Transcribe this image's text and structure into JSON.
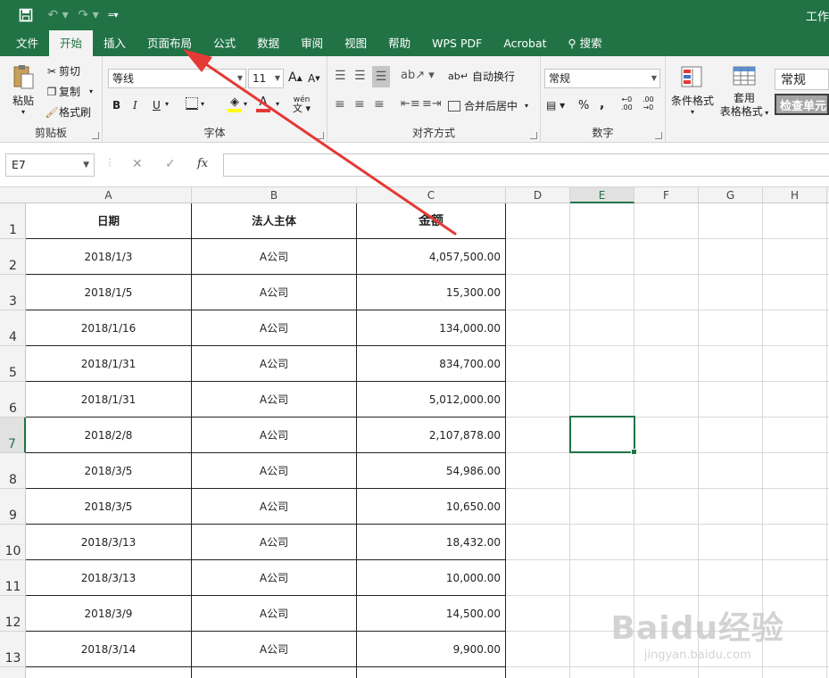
{
  "window": {
    "title": "工作"
  },
  "tabs": [
    {
      "label": "文件",
      "active": false
    },
    {
      "label": "开始",
      "active": true
    },
    {
      "label": "插入",
      "active": false
    },
    {
      "label": "页面布局",
      "active": false
    },
    {
      "label": "公式",
      "active": false
    },
    {
      "label": "数据",
      "active": false
    },
    {
      "label": "审阅",
      "active": false
    },
    {
      "label": "视图",
      "active": false
    },
    {
      "label": "帮助",
      "active": false
    },
    {
      "label": "WPS PDF",
      "active": false
    },
    {
      "label": "Acrobat",
      "active": false
    },
    {
      "label": "搜索",
      "active": false
    }
  ],
  "ribbon": {
    "clipboard": {
      "label": "剪贴板",
      "paste": "粘贴",
      "cut": "剪切",
      "copy": "复制",
      "format_painter": "格式刷"
    },
    "font": {
      "label": "字体",
      "font_name": "等线",
      "font_size": "11",
      "bold": "B",
      "italic": "I",
      "underline": "U",
      "pinyin": "wén"
    },
    "alignment": {
      "label": "对齐方式",
      "wrap_text": "自动换行",
      "merge_center": "合并后居中"
    },
    "number": {
      "label": "数字",
      "format": "常规",
      "percent": "%",
      "comma": ",",
      "inc_decimal": ".00",
      "dec_decimal": ".00"
    },
    "styles": {
      "conditional_format": "条件格式",
      "table_format_1": "套用",
      "table_format_2": "表格格式",
      "style_normal": "常规",
      "style_check": "检查单元"
    }
  },
  "formula_bar": {
    "name_box": "E7",
    "fx": "fx",
    "value": ""
  },
  "columns": [
    "A",
    "B",
    "C",
    "D",
    "E",
    "F",
    "G",
    "H"
  ],
  "selected_column": "E",
  "selected_row": "7",
  "rows": [
    "1",
    "2",
    "3",
    "4",
    "5",
    "6",
    "7",
    "8",
    "9",
    "10",
    "11",
    "12",
    "13"
  ],
  "table": {
    "headers": [
      "日期",
      "法人主体",
      "金额"
    ],
    "data": [
      [
        "2018/1/3",
        "A公司",
        "4,057,500.00"
      ],
      [
        "2018/1/5",
        "A公司",
        "15,300.00"
      ],
      [
        "2018/1/16",
        "A公司",
        "134,000.00"
      ],
      [
        "2018/1/31",
        "A公司",
        "834,700.00"
      ],
      [
        "2018/1/31",
        "A公司",
        "5,012,000.00"
      ],
      [
        "2018/2/8",
        "A公司",
        "2,107,878.00"
      ],
      [
        "2018/3/5",
        "A公司",
        "54,986.00"
      ],
      [
        "2018/3/5",
        "A公司",
        "10,650.00"
      ],
      [
        "2018/3/13",
        "A公司",
        "18,432.00"
      ],
      [
        "2018/3/13",
        "A公司",
        "10,000.00"
      ],
      [
        "2018/3/9",
        "A公司",
        "14,500.00"
      ],
      [
        "2018/3/14",
        "A公司",
        "9,900.00"
      ]
    ]
  },
  "watermark": {
    "brand": "Baidu经验",
    "url": "jingyan.baidu.com"
  },
  "colors": {
    "accent": "#217346",
    "arrow": "#e53935"
  }
}
